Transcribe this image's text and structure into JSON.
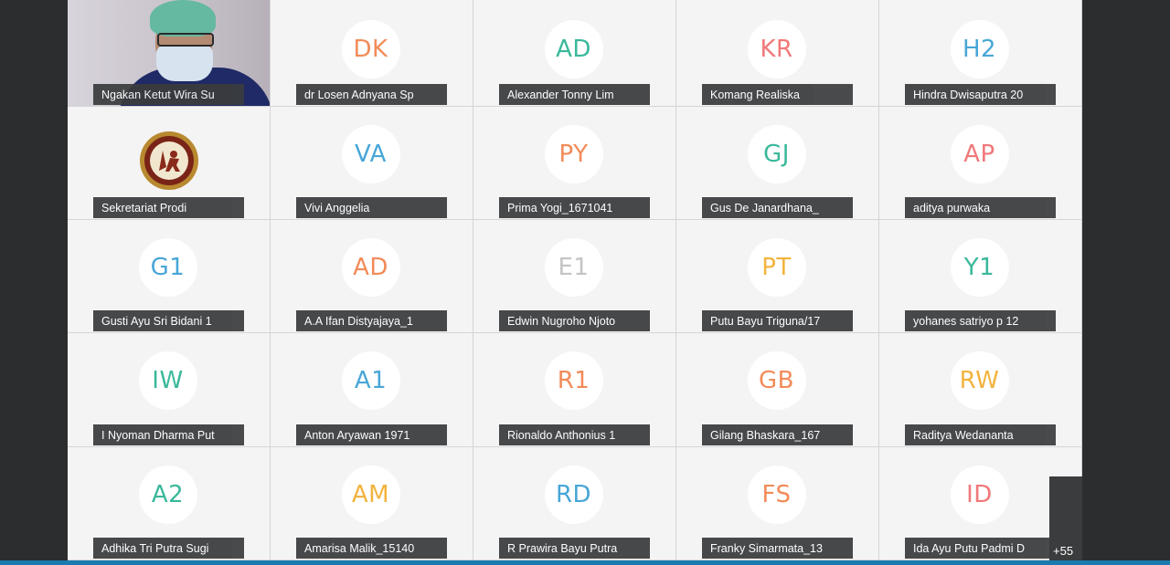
{
  "participants": [
    {
      "name": "Ngakan Ketut Wira Su",
      "type": "video"
    },
    {
      "name": "dr Losen Adnyana Sp",
      "initials": "DK",
      "color": "#f28b58"
    },
    {
      "name": "Alexander Tonny Lim",
      "initials": "AD",
      "color": "#3ab89a"
    },
    {
      "name": "Komang Realiska",
      "initials": "KR",
      "color": "#f0787a"
    },
    {
      "name": "Hindra Dwisaputra 20",
      "initials": "H2",
      "color": "#48a6d6"
    },
    {
      "name": "Sekretariat Prodi",
      "type": "logo"
    },
    {
      "name": "Vivi Anggelia",
      "initials": "VA",
      "color": "#48a6d6"
    },
    {
      "name": "Prima Yogi_1671041",
      "initials": "PY",
      "color": "#f28b58"
    },
    {
      "name": "Gus De Janardhana_",
      "initials": "GJ",
      "color": "#3ab89a"
    },
    {
      "name": "aditya purwaka",
      "initials": "AP",
      "color": "#f0787a"
    },
    {
      "name": "Gusti Ayu Sri Bidani 1",
      "initials": "G1",
      "color": "#48a6d6"
    },
    {
      "name": "A.A Ifan Distyajaya_1",
      "initials": "AD",
      "color": "#f28b58"
    },
    {
      "name": "Edwin Nugroho Njoto",
      "initials": "E1",
      "color": "#c4c4c4"
    },
    {
      "name": "Putu Bayu Triguna/17",
      "initials": "PT",
      "color": "#f2b33d"
    },
    {
      "name": "yohanes satriyo p 12",
      "initials": "Y1",
      "color": "#3ab89a"
    },
    {
      "name": "I Nyoman Dharma Put",
      "initials": "IW",
      "color": "#3ab89a"
    },
    {
      "name": "Anton Aryawan 1971",
      "initials": "A1",
      "color": "#48a6d6"
    },
    {
      "name": "Rionaldo Anthonius 1",
      "initials": "R1",
      "color": "#f28b58"
    },
    {
      "name": "Gilang Bhaskara_167",
      "initials": "GB",
      "color": "#f28b58"
    },
    {
      "name": "Raditya Wedananta",
      "initials": "RW",
      "color": "#f2b33d"
    },
    {
      "name": "Adhika Tri Putra Sugi",
      "initials": "A2",
      "color": "#3ab89a"
    },
    {
      "name": "Amarisa Malik_15140",
      "initials": "AM",
      "color": "#f2b33d"
    },
    {
      "name": "R Prawira Bayu Putra",
      "initials": "RD",
      "color": "#48a6d6"
    },
    {
      "name": "Franky Simarmata_13",
      "initials": "FS",
      "color": "#f28b58"
    },
    {
      "name": "Ida Ayu Putu Padmi D",
      "initials": "ID",
      "color": "#f0787a"
    }
  ],
  "more_participants_label": "+55",
  "accent_bar_color": "#1a7bb0"
}
